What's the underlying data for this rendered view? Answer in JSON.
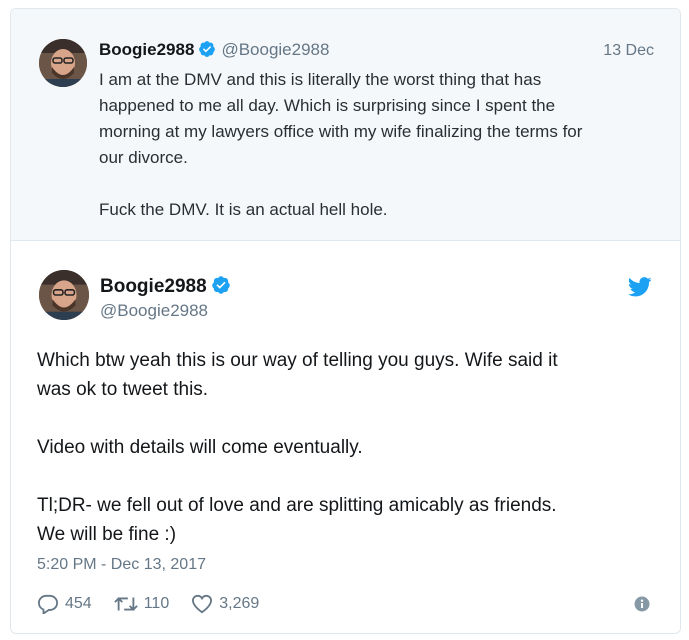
{
  "quoted_tweet": {
    "display_name": "Boogie2988",
    "handle": "@Boogie2988",
    "date": "13 Dec",
    "text": "I am at the DMV and this is literally the worst thing that has\nhappened to me all day. Which is surprising since I spent the\nmorning at my lawyers office with my wife finalizing the terms for\nour divorce.\n\nFuck the DMV. It is an actual hell hole."
  },
  "main_tweet": {
    "display_name": "Boogie2988",
    "handle": "@Boogie2988",
    "text": "Which btw yeah this is our way of telling you guys. Wife said it\nwas ok to tweet this.\n\nVideo with details will come eventually.\n\nTl;DR- we fell out of love and are splitting amicably as friends.\nWe will be fine :)",
    "timestamp": "5:20 PM - Dec 13, 2017",
    "replies": "454",
    "retweets": "110",
    "likes": "3,269"
  },
  "icons": {
    "verified": "verified-badge-icon",
    "bird": "twitter-bird-icon",
    "reply": "reply-icon",
    "retweet": "retweet-icon",
    "like": "heart-icon",
    "info": "info-icon"
  },
  "colors": {
    "twitter_blue": "#1da1f2",
    "muted_text": "#657786",
    "quoted_background": "#f5f8fa"
  }
}
